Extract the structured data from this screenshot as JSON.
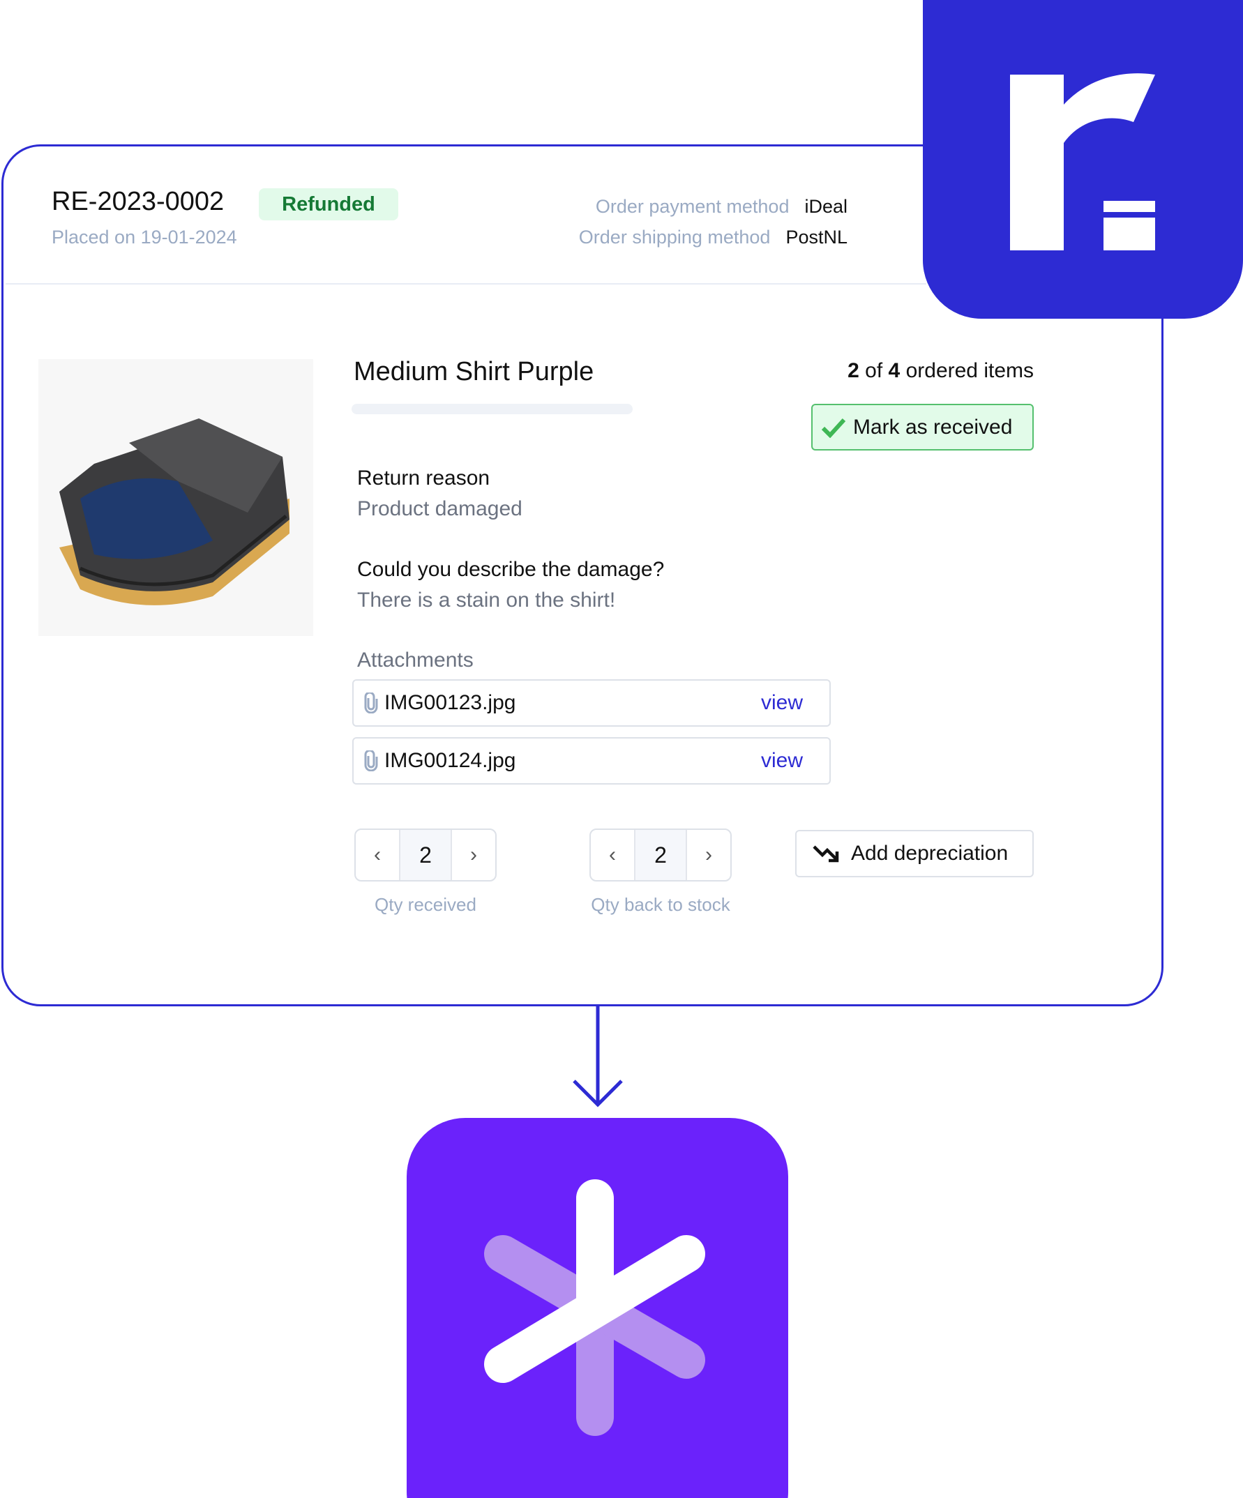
{
  "header": {
    "return_id": "RE-2023-0002",
    "status": "Refunded",
    "placed_on": "Placed on 19-01-2024",
    "payment_label": "Order payment method",
    "payment_value": "iDeal",
    "shipping_label": "Order shipping method",
    "shipping_value": "PostNL"
  },
  "item": {
    "title": "Medium Shirt Purple",
    "count_received": "2",
    "count_of": "of",
    "count_total": "4",
    "count_suffix": "ordered items",
    "mark_received_label": "Mark as received",
    "return_reason_label": "Return reason",
    "return_reason_value": "Product damaged",
    "question_label": "Could you describe the damage?",
    "question_answer": "There is a stain on the shirt!",
    "attachments_label": "Attachments",
    "attachments": [
      {
        "name": "IMG00123.jpg",
        "action": "view"
      },
      {
        "name": "IMG00124.jpg",
        "action": "view"
      }
    ],
    "qty_received": {
      "value": "2",
      "label": "Qty received"
    },
    "qty_back_to_stock": {
      "value": "2",
      "label": "Qty back to stock"
    },
    "add_depreciation_label": "Add depreciation"
  },
  "colors": {
    "brand_blue": "#2d2bd3",
    "brand_purple": "#6b22fb",
    "success": "#157a35"
  },
  "icons": [
    "r-logo",
    "check-icon",
    "paperclip-icon",
    "chevron-left-icon",
    "chevron-right-icon",
    "trend-down-icon",
    "arrow-down-icon",
    "asterisk-logo"
  ]
}
